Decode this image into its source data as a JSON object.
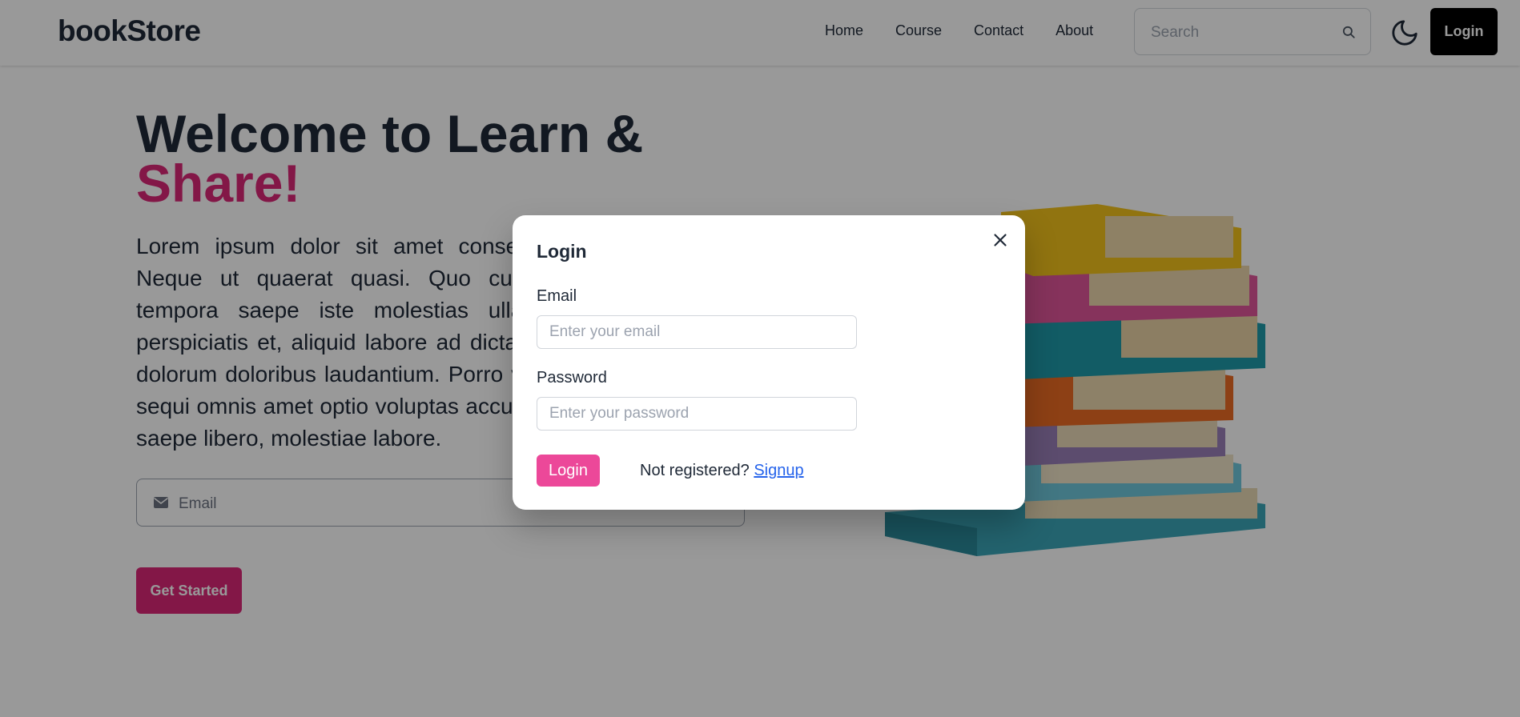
{
  "brand": "bookStore",
  "nav": {
    "links": [
      "Home",
      "Course",
      "Contact",
      "About"
    ],
    "search_placeholder": "Search",
    "login_label": "Login"
  },
  "hero": {
    "title_line1": "Welcome to Learn &",
    "title_line2": "Share!",
    "paragraph": "Lorem ipsum dolor sit amet consectetur adipisicing elit. Neque ut quaerat quasi. Quo cupiditate, consequuntur tempora saepe iste molestias ullam, reiciendis labore perspiciatis et, aliquid labore ad dicta reprehenderit quaerat dolorum doloribus laudantium. Porro voluptates eveniet a sit sequi omnis amet optio voluptas accusamus quaerat quaerat saepe libero, molestiae labore.",
    "email_placeholder": "Email",
    "cta_label": "Get Started"
  },
  "modal": {
    "title": "Login",
    "email_label": "Email",
    "email_placeholder": "Enter your email",
    "password_label": "Password",
    "password_placeholder": "Enter your password",
    "login_button": "Login",
    "not_registered": "Not registered?",
    "signup_link": "Signup"
  },
  "colors": {
    "accent_pink": "#db2777",
    "modal_button": "#ec4899",
    "link_blue": "#2563eb",
    "nav_login_bg": "#000000"
  },
  "icons": [
    "search-icon",
    "moon-icon",
    "mail-icon",
    "close-icon",
    "books-illustration"
  ]
}
